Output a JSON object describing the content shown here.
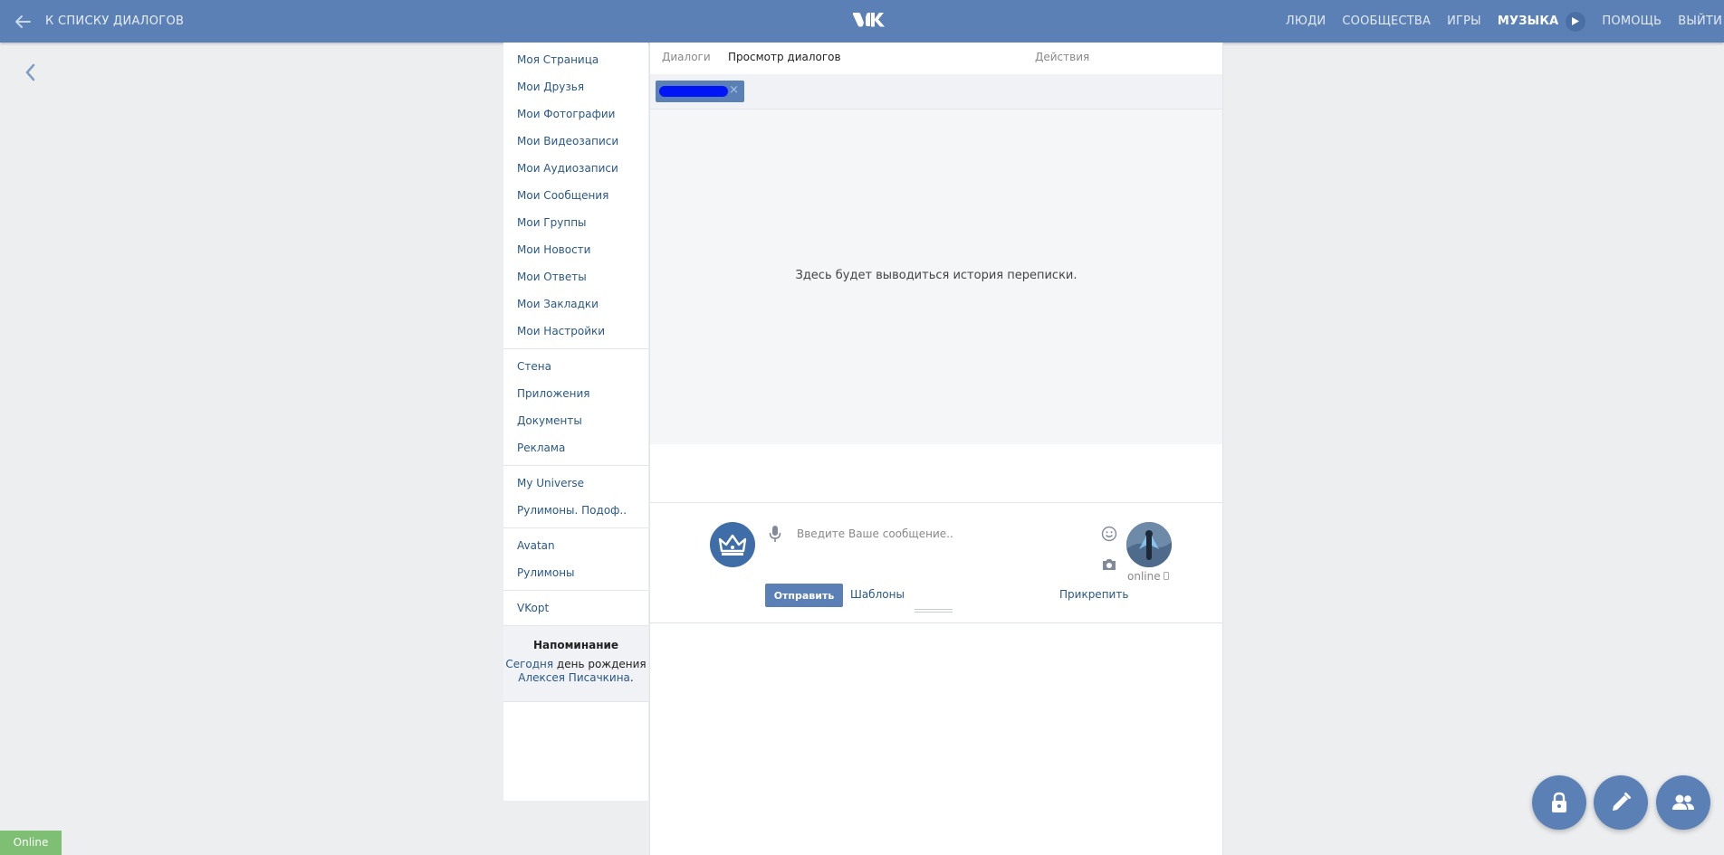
{
  "topbar": {
    "back_label": "К СПИСКУ ДИАЛОГОВ",
    "nav": [
      "ЛЮДИ",
      "СООБЩЕСТВА",
      "ИГРЫ",
      "МУЗЫКА",
      "ПОМОЩЬ",
      "ВЫЙТИ"
    ],
    "active_nav": "МУЗЫКА"
  },
  "sidebar": {
    "groups": [
      [
        "Моя Страница",
        "Мои Друзья",
        "Мои Фотографии",
        "Мои Видеозаписи",
        "Мои Аудиозаписи",
        "Мои Сообщения",
        "Мои Группы",
        "Мои Новости",
        "Мои Ответы",
        "Мои Закладки",
        "Мои Настройки"
      ],
      [
        "Стена",
        "Приложения",
        "Документы",
        "Реклама"
      ],
      [
        "My Universe",
        "Рулимоны. Подоф.."
      ],
      [
        "Avatan",
        "Рулимоны"
      ],
      [
        "VKopt"
      ]
    ],
    "reminder": {
      "title": "Напоминание",
      "today": "Сегодня",
      "text": " день рождения ",
      "name": "Алексея Писачкина",
      "suffix": "."
    }
  },
  "main": {
    "tabs": {
      "dialogs": "Диалоги",
      "view": "Просмотр диалогов",
      "actions": "Действия"
    },
    "history_placeholder": "Здесь будет выводиться история переписки.",
    "composer": {
      "placeholder": "Введите Ваше сообщение..",
      "send_label": "Отправить",
      "templates_label": "Шаблоны",
      "attach_label": "Прикрепить",
      "peer_status": "online"
    }
  },
  "status_badge": "Online",
  "colors": {
    "brand": "#5b80b6",
    "link": "#2a5885",
    "online": "#7fbf73"
  }
}
